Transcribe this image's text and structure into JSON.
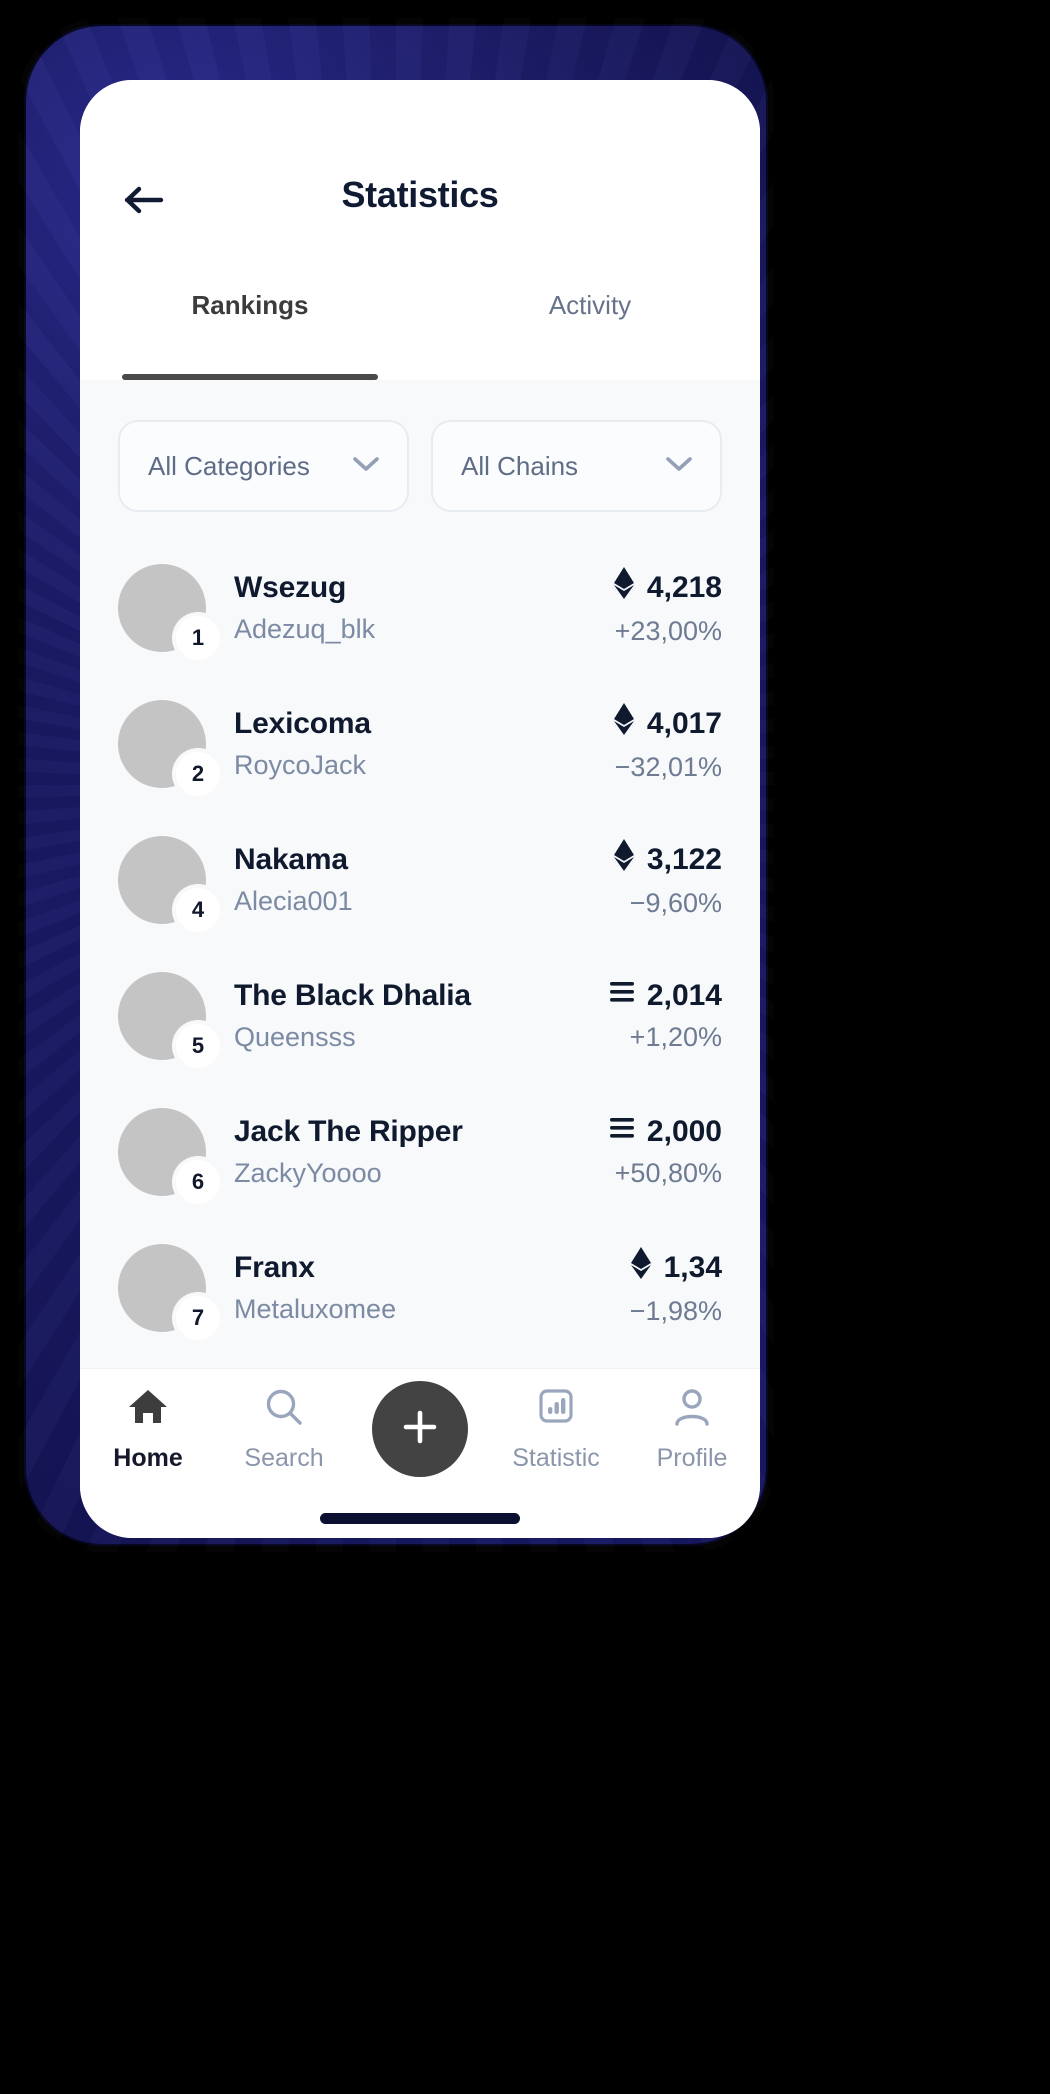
{
  "header": {
    "title": "Statistics",
    "back_icon": "arrow-left-icon"
  },
  "tabs": [
    {
      "label": "Rankings",
      "active": true
    },
    {
      "label": "Activity",
      "active": false
    }
  ],
  "filters": [
    {
      "label": "All Categories",
      "icon": "chevron-down-icon"
    },
    {
      "label": "All Chains",
      "icon": "chevron-down-icon"
    }
  ],
  "rankings": [
    {
      "rank": "1",
      "name": "Wsezug",
      "username": "Adezuq_blk",
      "chain_icon": "ethereum-icon",
      "value": "4,218",
      "change": "+23,00%"
    },
    {
      "rank": "2",
      "name": "Lexicoma",
      "username": "RoycoJack",
      "chain_icon": "ethereum-icon",
      "value": "4,017",
      "change": "−32,01%"
    },
    {
      "rank": "4",
      "name": "Nakama",
      "username": "Alecia001",
      "chain_icon": "ethereum-icon",
      "value": "3,122",
      "change": "−9,60%"
    },
    {
      "rank": "5",
      "name": "The Black Dhalia",
      "username": "Queensss",
      "chain_icon": "tezos-icon",
      "value": "2,014",
      "change": "+1,20%"
    },
    {
      "rank": "6",
      "name": "Jack The Ripper",
      "username": "ZackyYoooo",
      "chain_icon": "tezos-icon",
      "value": "2,000",
      "change": "+50,80%"
    },
    {
      "rank": "7",
      "name": "Franx",
      "username": "Metaluxomee",
      "chain_icon": "ethereum-icon",
      "value": "1,34",
      "change": "−1,98%"
    }
  ],
  "bottom_nav": [
    {
      "label": "Home",
      "icon": "home-icon",
      "active": true
    },
    {
      "label": "Search",
      "icon": "search-icon",
      "active": false
    },
    {
      "label": "",
      "icon": "plus-icon",
      "active": false
    },
    {
      "label": "Statistic",
      "icon": "bar-chart-icon",
      "active": false
    },
    {
      "label": "Profile",
      "icon": "person-icon",
      "active": false
    }
  ],
  "colors": {
    "frame": "#131347",
    "title": "#111a33",
    "muted": "#7c8aa3",
    "accent_tab": "#4a4a4a",
    "fab": "#434343",
    "body_bg": "#f7f9fb"
  }
}
